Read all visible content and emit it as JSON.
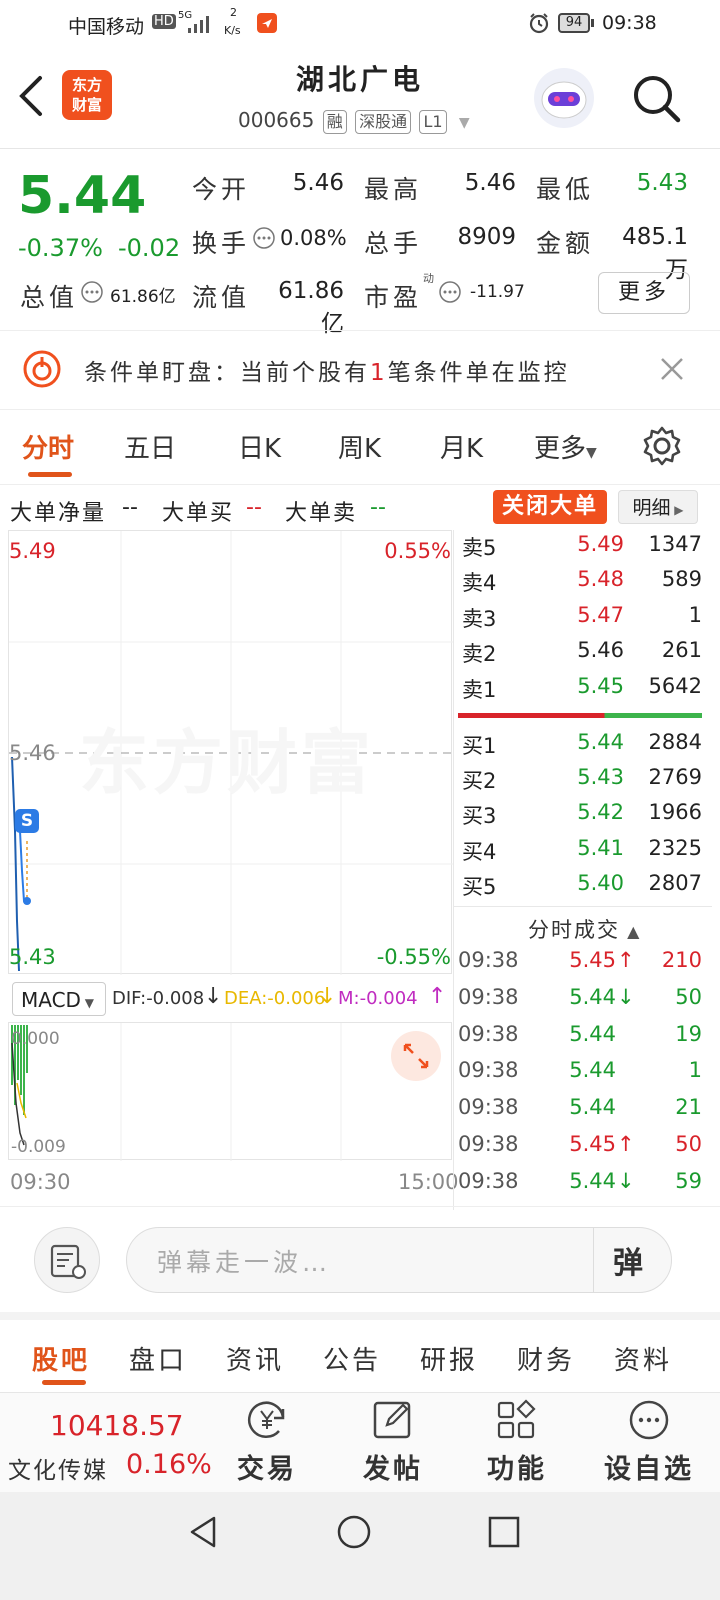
{
  "status_bar": {
    "carrier": "中国移动",
    "hd": "HD",
    "net_gen": "5G",
    "speed_value": "2",
    "speed_unit": "K/s",
    "battery": "94",
    "time": "09:38"
  },
  "header": {
    "logo_line1": "东方",
    "logo_line2": "财富",
    "stock_name": "湖北广电",
    "stock_code": "000665",
    "tags": [
      "融",
      "深股通",
      "L1"
    ]
  },
  "quote": {
    "price": "5.44",
    "change_pct": "-0.37%",
    "change_abs": "-0.02",
    "open_label": "今开",
    "open_value": "5.46",
    "high_label": "最高",
    "high_value": "5.46",
    "low_label": "最低",
    "low_value": "5.43",
    "turnover_label": "换手",
    "turnover_value": "0.08%",
    "volume_label": "总手",
    "volume_value": "8909",
    "amount_label": "金额",
    "amount_value": "485.1万",
    "mktcap_label": "总值",
    "mktcap_value": "61.86亿",
    "float_label": "流值",
    "float_value": "61.86亿",
    "pe_label": "市盈",
    "pe_sup": "动",
    "pe_value": "-11.97",
    "more_button": "更多"
  },
  "banner": {
    "text_prefix": "条件单盯盘：当前个股有",
    "text_count": "1",
    "text_suffix": "笔条件单在监控"
  },
  "chart_tabs": [
    "分时",
    "五日",
    "日K",
    "周K",
    "月K",
    "更多"
  ],
  "big_order": {
    "net_label": "大单净量",
    "net_value": "--",
    "buy_label": "大单买",
    "buy_value": "--",
    "sell_label": "大单卖",
    "sell_value": "--",
    "close_button": "关闭大单",
    "detail_button": "明细"
  },
  "intraday": {
    "y_top": "5.49",
    "y_top_pct": "0.55%",
    "y_mid": "5.46",
    "y_bottom": "5.43",
    "y_bottom_pct": "-0.55%",
    "watermark": "东方财富",
    "marker": "S",
    "time_start": "09:30",
    "time_end": "15:00"
  },
  "macd": {
    "name": "MACD",
    "dif": "DIF:-0.008",
    "dea": "DEA:-0.006",
    "m": "M:-0.004",
    "y_top": "0.000",
    "y_bottom": "-0.009"
  },
  "order_book": {
    "asks": [
      {
        "label": "卖5",
        "price": "5.49",
        "vol": "1347",
        "color": "#d8232a"
      },
      {
        "label": "卖4",
        "price": "5.48",
        "vol": "589",
        "color": "#d8232a"
      },
      {
        "label": "卖3",
        "price": "5.47",
        "vol": "1",
        "color": "#d8232a"
      },
      {
        "label": "卖2",
        "price": "5.46",
        "vol": "261",
        "color": "#222222"
      },
      {
        "label": "卖1",
        "price": "5.45",
        "vol": "5642",
        "color": "#1a9a2e"
      }
    ],
    "bids": [
      {
        "label": "买1",
        "price": "5.44",
        "vol": "2884",
        "color": "#1a9a2e"
      },
      {
        "label": "买2",
        "price": "5.43",
        "vol": "2769",
        "color": "#1a9a2e"
      },
      {
        "label": "买3",
        "price": "5.42",
        "vol": "1966",
        "color": "#1a9a2e"
      },
      {
        "label": "买4",
        "price": "5.41",
        "vol": "2325",
        "color": "#1a9a2e"
      },
      {
        "label": "买5",
        "price": "5.40",
        "vol": "2807",
        "color": "#1a9a2e"
      }
    ],
    "trades_title": "分时成交",
    "trades": [
      {
        "time": "09:38",
        "price": "5.45",
        "arrow": "↑",
        "vol": "210",
        "color": "#d8232a"
      },
      {
        "time": "09:38",
        "price": "5.44",
        "arrow": "↓",
        "vol": "50",
        "color": "#1a9a2e"
      },
      {
        "time": "09:38",
        "price": "5.44",
        "arrow": "",
        "vol": "19",
        "color": "#1a9a2e"
      },
      {
        "time": "09:38",
        "price": "5.44",
        "arrow": "",
        "vol": "1",
        "color": "#1a9a2e"
      },
      {
        "time": "09:38",
        "price": "5.44",
        "arrow": "",
        "vol": "21",
        "color": "#1a9a2e"
      },
      {
        "time": "09:38",
        "price": "5.45",
        "arrow": "↑",
        "vol": "50",
        "color": "#d8232a"
      },
      {
        "time": "09:38",
        "price": "5.44",
        "arrow": "↓",
        "vol": "59",
        "color": "#1a9a2e"
      }
    ]
  },
  "comment": {
    "placeholder": "弹幕走一波…",
    "danmu_button": "弹"
  },
  "bottom_tabs": [
    "股吧",
    "盘口",
    "资讯",
    "公告",
    "研报",
    "财务",
    "资料"
  ],
  "bottom_nav": {
    "index_value": "10418.57",
    "index_name": "文化传媒",
    "index_change": "0.16%",
    "trade": "交易",
    "post": "发帖",
    "func": "功能",
    "watch": "设自选"
  }
}
